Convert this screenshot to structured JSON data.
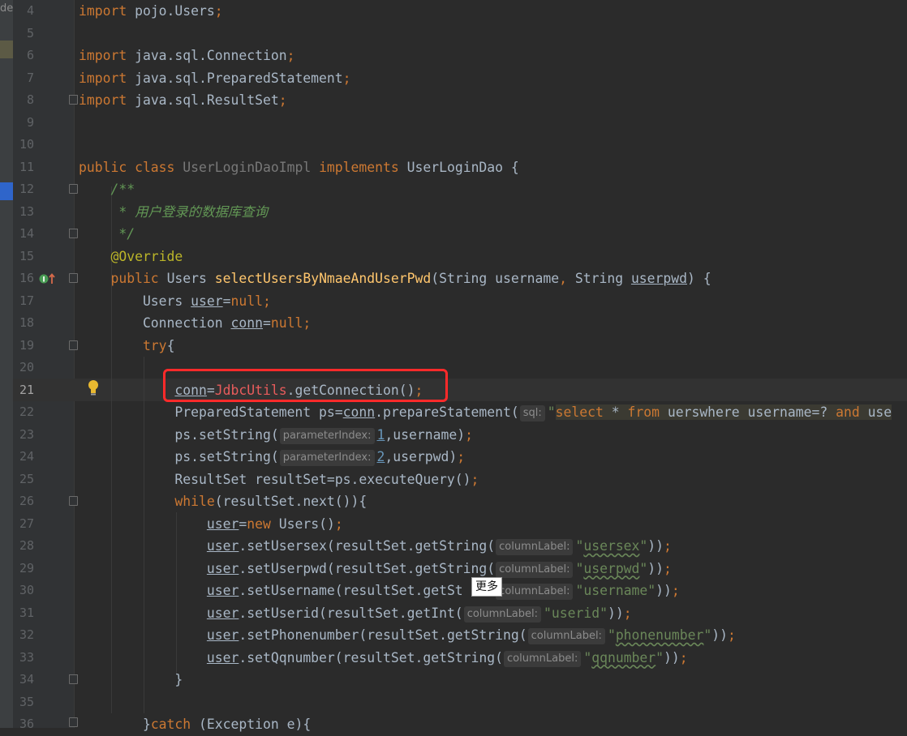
{
  "sidebar": {
    "partial_label": "der"
  },
  "editor": {
    "current_line": "21",
    "lines": [
      {
        "n": "4",
        "segs": [
          [
            "kw",
            "import "
          ],
          [
            "",
            "pojo.Users"
          ],
          [
            "kw",
            ";"
          ]
        ]
      },
      {
        "n": "5",
        "segs": []
      },
      {
        "n": "6",
        "segs": [
          [
            "kw",
            "import "
          ],
          [
            "",
            "java.sql.Connection"
          ],
          [
            "kw",
            ";"
          ]
        ]
      },
      {
        "n": "7",
        "segs": [
          [
            "kw",
            "import "
          ],
          [
            "",
            "java.sql.PreparedStatement"
          ],
          [
            "kw",
            ";"
          ]
        ]
      },
      {
        "n": "8",
        "segs": [
          [
            "kw",
            "import "
          ],
          [
            "",
            "java.sql.ResultSet"
          ],
          [
            "kw",
            ";"
          ]
        ]
      },
      {
        "n": "9",
        "segs": []
      },
      {
        "n": "10",
        "segs": []
      },
      {
        "n": "11",
        "segs": [
          [
            "kw",
            "public class "
          ],
          [
            "gray",
            "UserLoginDaoImpl "
          ],
          [
            "kw",
            "implements "
          ],
          [
            "",
            "UserLoginDao {"
          ]
        ]
      },
      {
        "n": "12",
        "segs": [
          [
            "doc",
            "    /**"
          ]
        ]
      },
      {
        "n": "13",
        "segs": [
          [
            "doc",
            "     * 用户登录的数据库查询"
          ]
        ]
      },
      {
        "n": "14",
        "segs": [
          [
            "doc",
            "     */"
          ]
        ]
      },
      {
        "n": "15",
        "segs": [
          [
            "ann",
            "    @Override"
          ]
        ]
      },
      {
        "n": "16",
        "segs": [
          [
            "kw",
            "    public "
          ],
          [
            "",
            "Users "
          ],
          [
            "method",
            "selectUsersByNmaeAndUserPwd"
          ],
          [
            "",
            "(String username"
          ],
          [
            "kw",
            ", "
          ],
          [
            "",
            "String "
          ],
          [
            "squigw",
            "userpwd"
          ],
          [
            "",
            ") {"
          ]
        ]
      },
      {
        "n": "17",
        "segs": [
          [
            "",
            "        Users "
          ],
          [
            "ul",
            "user"
          ],
          [
            "",
            "="
          ],
          [
            "kw",
            "null;"
          ]
        ]
      },
      {
        "n": "18",
        "segs": [
          [
            "",
            "        Connection "
          ],
          [
            "ul",
            "conn"
          ],
          [
            "",
            "="
          ],
          [
            "kw",
            "null;"
          ]
        ]
      },
      {
        "n": "19",
        "segs": [
          [
            "kw",
            "        try"
          ],
          [
            "",
            "{"
          ]
        ]
      },
      {
        "n": "20",
        "segs": []
      },
      {
        "n": "21",
        "segs": [
          [
            "",
            "            "
          ],
          [
            "ul",
            "conn"
          ],
          [
            "",
            "="
          ],
          [
            "red",
            "JdbcUtils"
          ],
          [
            "",
            ".getConnection()"
          ],
          [
            "kw",
            ";"
          ]
        ]
      },
      {
        "n": "22",
        "segs": [
          [
            "",
            "            PreparedStatement ps="
          ],
          [
            "ul",
            "conn"
          ],
          [
            "",
            ".prepareStatement("
          ],
          [
            "hint",
            "sql:"
          ],
          [
            "str",
            "\""
          ],
          [
            "sqlkw",
            "select "
          ],
          [
            "sqlop",
            "* "
          ],
          [
            "sqlkw",
            "from "
          ],
          [
            "sqlt",
            "uerswhere username=? "
          ],
          [
            "sqlkw",
            "and "
          ],
          [
            "sqlt",
            "use"
          ]
        ]
      },
      {
        "n": "23",
        "segs": [
          [
            "",
            "            ps.setString("
          ],
          [
            "hint",
            "parameterIndex:"
          ],
          [
            "numu",
            "1"
          ],
          [
            "",
            ",username)"
          ],
          [
            "kw",
            ";"
          ]
        ]
      },
      {
        "n": "24",
        "segs": [
          [
            "",
            "            ps.setString("
          ],
          [
            "hint",
            "parameterIndex:"
          ],
          [
            "numu",
            "2"
          ],
          [
            "",
            ",userpwd)"
          ],
          [
            "kw",
            ";"
          ]
        ]
      },
      {
        "n": "25",
        "segs": [
          [
            "",
            "            ResultSet resultSet=ps.executeQuery()"
          ],
          [
            "kw",
            ";"
          ]
        ]
      },
      {
        "n": "26",
        "segs": [
          [
            "kw",
            "            while"
          ],
          [
            "",
            "(resultSet.next()){"
          ]
        ]
      },
      {
        "n": "27",
        "segs": [
          [
            "",
            "                "
          ],
          [
            "ul",
            "user"
          ],
          [
            "",
            "="
          ],
          [
            "kw",
            "new "
          ],
          [
            "",
            "Users()"
          ],
          [
            "kw",
            ";"
          ]
        ]
      },
      {
        "n": "28",
        "segs": [
          [
            "",
            "                "
          ],
          [
            "ul",
            "user"
          ],
          [
            "",
            ".setUsersex(resultSet.getString("
          ],
          [
            "hint",
            "columnLabel:"
          ],
          [
            "str",
            "\""
          ],
          [
            "squig",
            "usersex"
          ],
          [
            "str",
            "\""
          ],
          [
            "",
            "))"
          ],
          [
            "kw",
            ";"
          ]
        ]
      },
      {
        "n": "29",
        "segs": [
          [
            "",
            "                "
          ],
          [
            "ul",
            "user"
          ],
          [
            "",
            ".setUserpwd(resultSet.getString("
          ],
          [
            "hint",
            "columnLabel:"
          ],
          [
            "str",
            "\""
          ],
          [
            "squig",
            "userpwd"
          ],
          [
            "str",
            "\""
          ],
          [
            "",
            "))"
          ],
          [
            "kw",
            ";"
          ]
        ]
      },
      {
        "n": "30",
        "segs": [
          [
            "",
            "                "
          ],
          [
            "ul",
            "user"
          ],
          [
            "",
            ".setUsername(resultSet.getSt"
          ],
          [
            "",
            "    "
          ],
          [
            "hint",
            "columnLabel:"
          ],
          [
            "str",
            "\"username\""
          ],
          [
            "",
            "))"
          ],
          [
            "kw",
            ";"
          ]
        ]
      },
      {
        "n": "31",
        "segs": [
          [
            "",
            "                "
          ],
          [
            "ul",
            "user"
          ],
          [
            "",
            ".setUserid(resultSet.getInt("
          ],
          [
            "hint",
            "columnLabel:"
          ],
          [
            "str",
            "\"userid\""
          ],
          [
            "",
            "))"
          ],
          [
            "kw",
            ";"
          ]
        ]
      },
      {
        "n": "32",
        "segs": [
          [
            "",
            "                "
          ],
          [
            "ul",
            "user"
          ],
          [
            "",
            ".setPhonenumber(resultSet.getString("
          ],
          [
            "hint",
            "columnLabel:"
          ],
          [
            "str",
            "\""
          ],
          [
            "squig",
            "phonenumber"
          ],
          [
            "str",
            "\""
          ],
          [
            "",
            "))"
          ],
          [
            "kw",
            ";"
          ]
        ]
      },
      {
        "n": "33",
        "segs": [
          [
            "",
            "                "
          ],
          [
            "ul",
            "user"
          ],
          [
            "",
            ".setQqnumber(resultSet.getString("
          ],
          [
            "hint",
            "columnLabel:"
          ],
          [
            "str",
            "\""
          ],
          [
            "squig",
            "qqnumber"
          ],
          [
            "str",
            "\""
          ],
          [
            "",
            "))"
          ],
          [
            "kw",
            ";"
          ]
        ]
      },
      {
        "n": "34",
        "segs": [
          [
            "",
            "            }"
          ]
        ]
      },
      {
        "n": "35",
        "segs": []
      },
      {
        "n": "36",
        "segs": [
          [
            "",
            "        }"
          ],
          [
            "kw",
            "catch "
          ],
          [
            "",
            "(Exception e){"
          ]
        ]
      }
    ]
  },
  "tooltip": {
    "text": "更多"
  },
  "colors": {
    "highlight_box": "#ff2a2a",
    "background": "#2b2b2b"
  }
}
